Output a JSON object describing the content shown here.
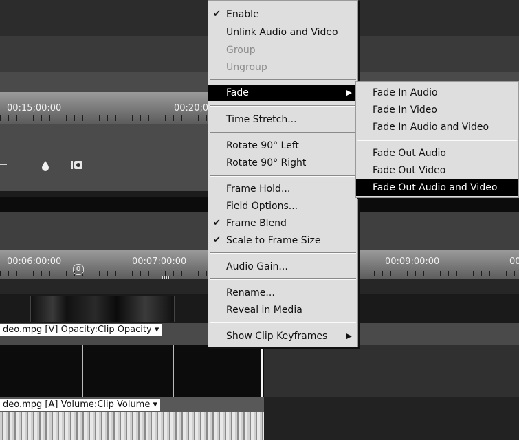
{
  "timeline": {
    "top_timecodes": [
      "00:15;00:00",
      "00:20;0"
    ],
    "bottom_timecodes": [
      "00:06:00:00",
      "00:07:00:00",
      "00:09:00:00",
      "00"
    ],
    "playhead_label": "0",
    "video_track_label": {
      "file": "deo.mpg",
      "rest": " [V] Opacity:Clip Opacity ▾"
    },
    "audio_track_label": {
      "file": "deo.mpg",
      "rest": " [A] Volume:Clip Volume ▾"
    }
  },
  "context_menu": {
    "items": [
      {
        "label": "Enable",
        "checked": true,
        "enabled": true
      },
      {
        "label": "Unlink Audio and Video",
        "enabled": true
      },
      {
        "label": "Group",
        "enabled": false
      },
      {
        "label": "Ungroup",
        "enabled": false
      },
      {
        "label": "Fade",
        "submenu": true,
        "highlighted": true
      },
      {
        "label": "Time Stretch...",
        "enabled": true
      },
      {
        "label": "Rotate 90° Left",
        "enabled": true
      },
      {
        "label": "Rotate 90° Right",
        "enabled": true
      },
      {
        "label": "Frame Hold...",
        "enabled": true
      },
      {
        "label": "Field Options...",
        "enabled": true
      },
      {
        "label": "Frame Blend",
        "checked": true,
        "enabled": true
      },
      {
        "label": "Scale to Frame Size",
        "checked": true,
        "enabled": true
      },
      {
        "label": "Audio Gain...",
        "enabled": true
      },
      {
        "label": "Rename...",
        "enabled": true
      },
      {
        "label": "Reveal in Media",
        "enabled": true
      },
      {
        "label": "Show Clip Keyframes",
        "submenu": true
      }
    ],
    "check_glyph": "✔",
    "arrow_glyph": "▶"
  },
  "fade_submenu": {
    "items": [
      {
        "label": "Fade In Audio"
      },
      {
        "label": "Fade In Video"
      },
      {
        "label": "Fade In Audio and Video"
      },
      {
        "label": "Fade Out Audio"
      },
      {
        "label": "Fade Out Video"
      },
      {
        "label": "Fade Out Audio and Video",
        "highlighted": true
      }
    ]
  },
  "icons": [
    "drop-icon",
    "camera-icon",
    "scrollbar-arrow-icon"
  ]
}
